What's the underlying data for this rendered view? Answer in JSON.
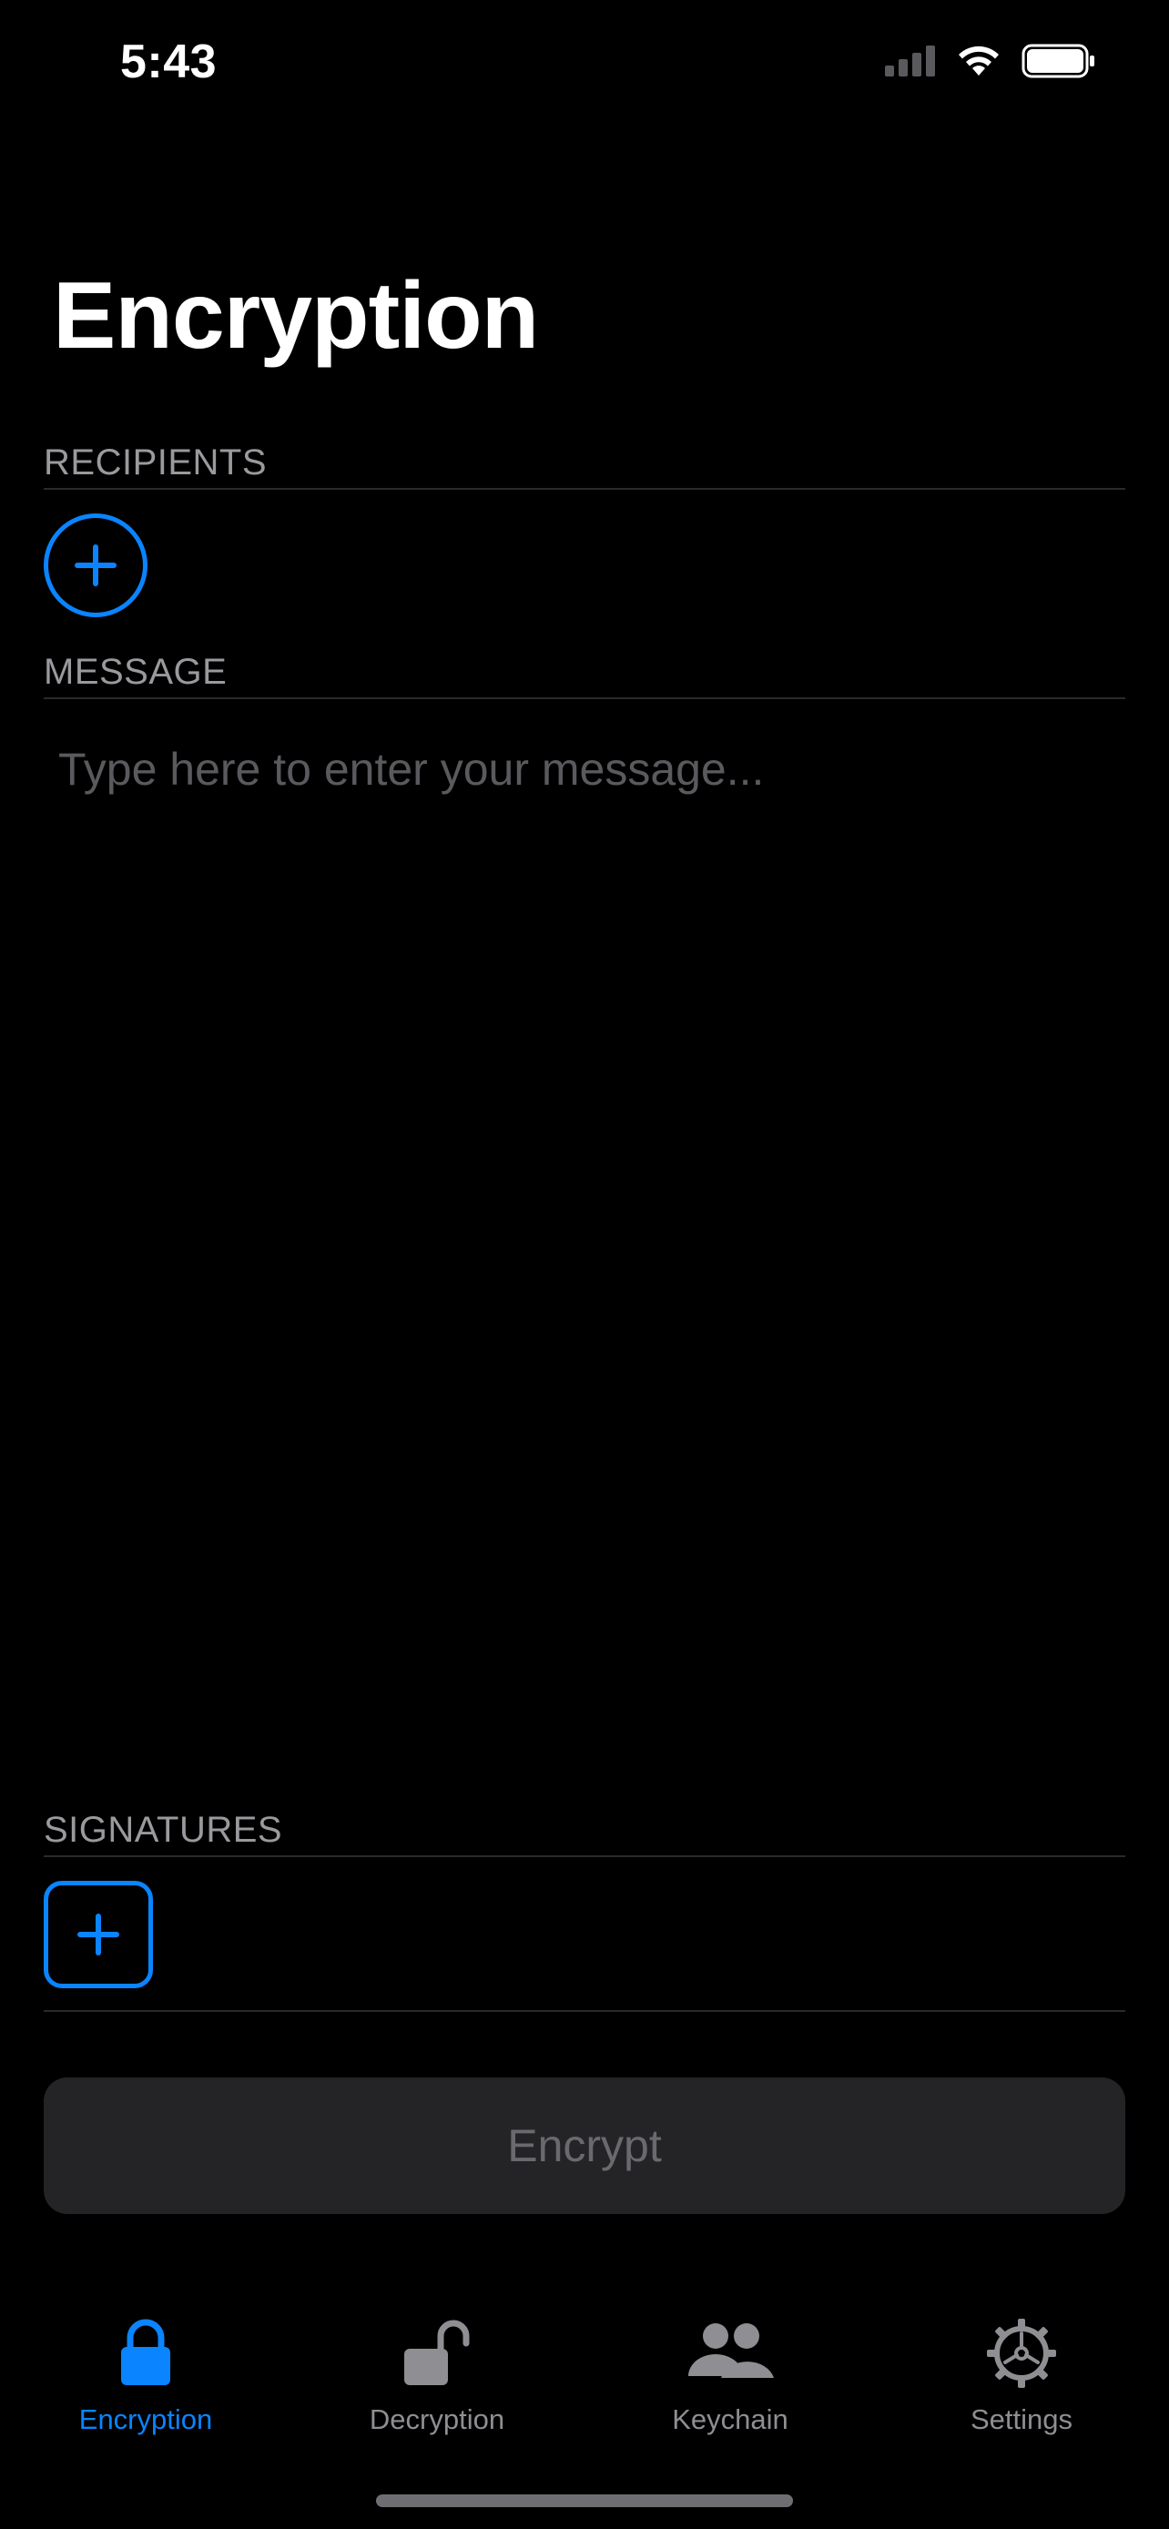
{
  "status_bar": {
    "time": "5:43"
  },
  "page": {
    "title": "Encryption"
  },
  "sections": {
    "recipients": "RECIPIENTS",
    "message": "MESSAGE",
    "signatures": "SIGNATURES"
  },
  "message": {
    "placeholder": "Type here to enter your message...",
    "value": ""
  },
  "encrypt_button": {
    "label": "Encrypt",
    "enabled": false
  },
  "tab_bar": {
    "items": [
      {
        "label": "Encryption",
        "icon": "lock-icon",
        "active": true
      },
      {
        "label": "Decryption",
        "icon": "lock-open-icon",
        "active": false
      },
      {
        "label": "Keychain",
        "icon": "people-icon",
        "active": false
      },
      {
        "label": "Settings",
        "icon": "gear-icon",
        "active": false
      }
    ]
  },
  "colors": {
    "accent": "#0a84ff",
    "background": "#000000",
    "secondary_text": "#9a9a9e",
    "tab_inactive": "#8e8e93",
    "button_bg": "#242426"
  }
}
